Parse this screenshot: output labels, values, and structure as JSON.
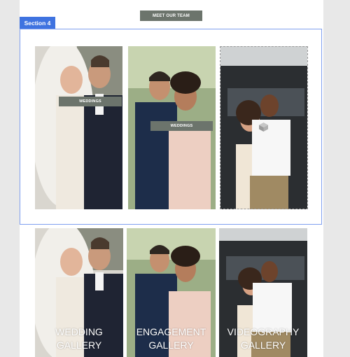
{
  "team_button": {
    "label": "MEET OUR TEAM"
  },
  "section_tag": {
    "label": "Section 4"
  },
  "top_row": [
    {
      "image": "bride-groom-photo",
      "button": "WEDDINGS"
    },
    {
      "image": "engaged-couple-photo",
      "button": "WEDDINGS"
    },
    {
      "image": "couple-by-car-photo"
    }
  ],
  "gallery_row": [
    {
      "image": "bride-groom-photo",
      "label": "WEDDING\nGALLERY"
    },
    {
      "image": "engaged-couple-photo",
      "label": "ENGAGEMENT\nGALLERY"
    },
    {
      "image": "couple-by-car-photo",
      "label": "VIDEOGRAPHY\nGALLERY"
    }
  ],
  "colors": {
    "accent": "#3f73e0",
    "button_bg": "#6c746c",
    "page_bg": "#e8e8e8"
  }
}
